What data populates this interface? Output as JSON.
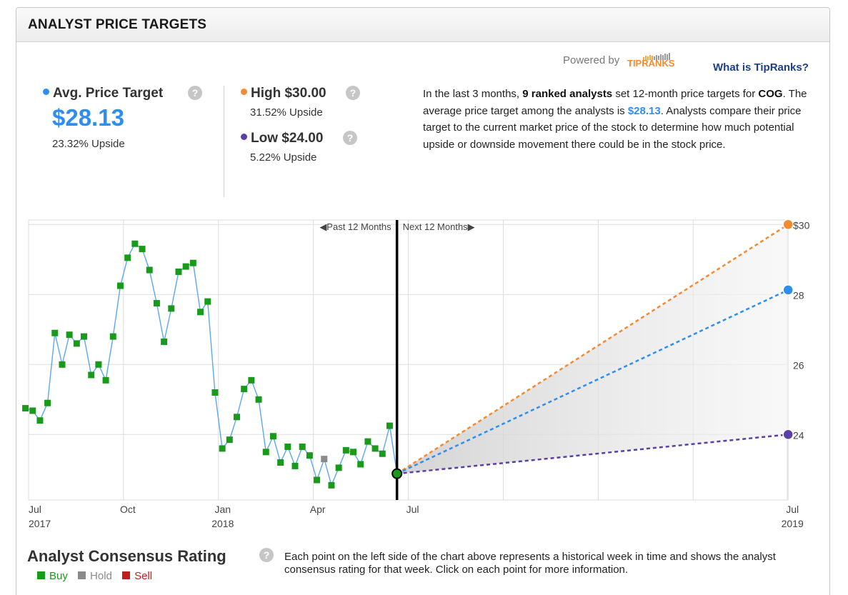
{
  "header": {
    "title": "ANALYST PRICE TARGETS"
  },
  "powered_by": {
    "label": "Powered by",
    "logo_text": "TIPRANKS",
    "link": "What is TipRanks?"
  },
  "avg": {
    "label": "Avg. Price Target",
    "value": "$28.13",
    "upside": "23.32% Upside",
    "color": "#2e8ef0"
  },
  "high": {
    "label": "High $30.00",
    "upside": "31.52% Upside",
    "color": "#f28b30"
  },
  "low": {
    "label": "Low $24.00",
    "upside": "5.22% Upside",
    "color": "#5b3ea6"
  },
  "help_glyph": "?",
  "description": {
    "p1": "In the last 3 months, ",
    "b1": "9 ranked analysts",
    "p2": " set 12-month price targets for ",
    "b2": "COG",
    "p3": ". The average price target among the analysts is ",
    "hl": "$28.13",
    "p4": ". Analysts compare their price target to the current market price of the stock to determine how much potential upside or downside movement there could be in the stock price."
  },
  "chart_data": {
    "type": "line",
    "past_label": "Past 12 Months",
    "next_label": "Next 12 Months",
    "x_ticks": [
      {
        "label": "Jul",
        "sub": "2017",
        "t": 0
      },
      {
        "label": "Oct",
        "sub": "",
        "t": 3
      },
      {
        "label": "Jan",
        "sub": "2018",
        "t": 6
      },
      {
        "label": "Apr",
        "sub": "",
        "t": 9
      },
      {
        "label": "Jul",
        "sub": "",
        "t": 12
      },
      {
        "label": "Jul",
        "sub": "2019",
        "t": 24
      }
    ],
    "y_ticks": [
      {
        "label": "$30",
        "v": 30
      },
      {
        "label": "28",
        "v": 28
      },
      {
        "label": "26",
        "v": 26
      },
      {
        "label": "24",
        "v": 24
      }
    ],
    "ylim": [
      21.95,
      30.2
    ],
    "history": [
      {
        "t": -0.1,
        "v": 24.75,
        "r": "buy"
      },
      {
        "t": 0.13,
        "v": 24.68,
        "r": "buy"
      },
      {
        "t": 0.36,
        "v": 24.4,
        "r": "buy"
      },
      {
        "t": 0.6,
        "v": 24.9,
        "r": "buy"
      },
      {
        "t": 0.83,
        "v": 26.9,
        "r": "buy"
      },
      {
        "t": 1.06,
        "v": 26.0,
        "r": "buy"
      },
      {
        "t": 1.29,
        "v": 26.85,
        "r": "buy"
      },
      {
        "t": 1.52,
        "v": 26.6,
        "r": "buy"
      },
      {
        "t": 1.75,
        "v": 26.8,
        "r": "buy"
      },
      {
        "t": 1.98,
        "v": 25.7,
        "r": "buy"
      },
      {
        "t": 2.21,
        "v": 26.0,
        "r": "buy"
      },
      {
        "t": 2.44,
        "v": 25.55,
        "r": "buy"
      },
      {
        "t": 2.67,
        "v": 26.8,
        "r": "buy"
      },
      {
        "t": 2.9,
        "v": 28.25,
        "r": "buy"
      },
      {
        "t": 3.13,
        "v": 29.05,
        "r": "buy"
      },
      {
        "t": 3.36,
        "v": 29.45,
        "r": "buy"
      },
      {
        "t": 3.59,
        "v": 29.3,
        "r": "buy"
      },
      {
        "t": 3.82,
        "v": 28.7,
        "r": "buy"
      },
      {
        "t": 4.05,
        "v": 27.75,
        "r": "buy"
      },
      {
        "t": 4.28,
        "v": 26.65,
        "r": "buy"
      },
      {
        "t": 4.51,
        "v": 27.6,
        "r": "buy"
      },
      {
        "t": 4.74,
        "v": 28.65,
        "r": "buy"
      },
      {
        "t": 4.97,
        "v": 28.8,
        "r": "buy"
      },
      {
        "t": 5.2,
        "v": 28.9,
        "r": "buy"
      },
      {
        "t": 5.43,
        "v": 27.5,
        "r": "buy"
      },
      {
        "t": 5.66,
        "v": 27.8,
        "r": "buy"
      },
      {
        "t": 5.89,
        "v": 25.2,
        "r": "buy"
      },
      {
        "t": 6.12,
        "v": 23.6,
        "r": "buy"
      },
      {
        "t": 6.35,
        "v": 23.85,
        "r": "buy"
      },
      {
        "t": 6.58,
        "v": 24.5,
        "r": "buy"
      },
      {
        "t": 6.81,
        "v": 25.3,
        "r": "buy"
      },
      {
        "t": 7.04,
        "v": 25.55,
        "r": "buy"
      },
      {
        "t": 7.27,
        "v": 25.0,
        "r": "buy"
      },
      {
        "t": 7.5,
        "v": 23.5,
        "r": "buy"
      },
      {
        "t": 7.73,
        "v": 23.95,
        "r": "buy"
      },
      {
        "t": 7.96,
        "v": 23.2,
        "r": "buy"
      },
      {
        "t": 8.19,
        "v": 23.65,
        "r": "buy"
      },
      {
        "t": 8.42,
        "v": 23.1,
        "r": "buy"
      },
      {
        "t": 8.65,
        "v": 23.65,
        "r": "buy"
      },
      {
        "t": 8.88,
        "v": 23.4,
        "r": "buy"
      },
      {
        "t": 9.11,
        "v": 22.7,
        "r": "buy"
      },
      {
        "t": 9.34,
        "v": 23.3,
        "r": "hold"
      },
      {
        "t": 9.57,
        "v": 22.55,
        "r": "buy"
      },
      {
        "t": 9.8,
        "v": 23.05,
        "r": "buy"
      },
      {
        "t": 10.03,
        "v": 23.55,
        "r": "buy"
      },
      {
        "t": 10.26,
        "v": 23.5,
        "r": "buy"
      },
      {
        "t": 10.49,
        "v": 23.15,
        "r": "buy"
      },
      {
        "t": 10.72,
        "v": 23.8,
        "r": "buy"
      },
      {
        "t": 10.95,
        "v": 23.6,
        "r": "buy"
      },
      {
        "t": 11.18,
        "v": 23.45,
        "r": "buy"
      },
      {
        "t": 11.41,
        "v": 24.25,
        "r": "buy"
      },
      {
        "t": 11.64,
        "v": 22.88,
        "r": "current"
      }
    ],
    "current": {
      "t": 11.64,
      "v": 22.88
    },
    "forecast": {
      "t": 24,
      "high": 30.0,
      "avg": 28.13,
      "low": 24.0
    },
    "colors": {
      "buy": "#1a9a1a",
      "hold": "#8a8a8a",
      "sell": "#c01f1f",
      "line": "#5aa9ea",
      "grid": "#dddddd",
      "label": "#444444"
    }
  },
  "consensus": {
    "title": "Analyst Consensus Rating",
    "buy": "Buy",
    "hold": "Hold",
    "sell": "Sell",
    "description": "Each point on the left side of the chart above represents a historical week in time and shows the analyst consensus rating for that week. Click on each point for more information."
  }
}
